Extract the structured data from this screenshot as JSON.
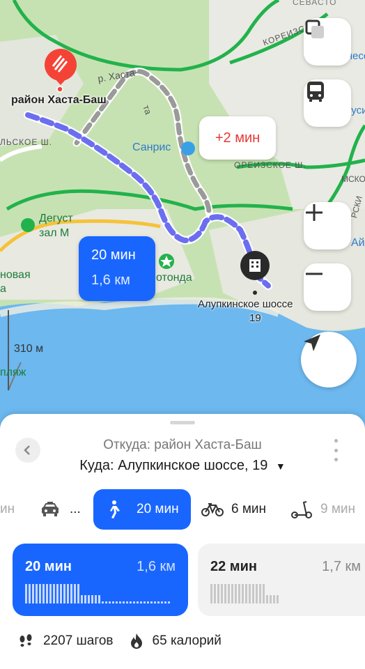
{
  "map": {
    "places": {
      "start_area": "район Хаста-Баш",
      "sevastop": "СЕВАСТО",
      "koreiz_top": "КОРЕИЗС",
      "reness": "Ренесса",
      "ulitsa": "р. Хаста-",
      "ta": "та",
      "alsk": "ЛЬСКОЕ Ш.",
      "sanris": "Санрис",
      "koreiz_road": "ОРЕИЗСКОЕ Ш.",
      "degust_1": "Дегуст",
      "degust_2": "зал М",
      "beach_left_1": "новая",
      "beach_left_2": "а",
      "rotonda": "отонда",
      "dest_1": "Алупкинское шоссе",
      "dest_2": "19",
      "sk": "РСКИ",
      "ai": "Ай",
      "nusi": "нуси",
      "mskoe": "МСКОЕ",
      "plyazh": "пляж",
      "scale": "310 м"
    },
    "traffic_bubble": "+2 мин",
    "route_bubble": {
      "time": "20 мин",
      "distance": "1,6 км"
    },
    "colors": {
      "route": "#6c6ef0",
      "alt_route": "#9a9a9a",
      "sea": "#6cb8ef",
      "land": "#c9e3b4",
      "road": "#22b24c",
      "yellow": "#f5c23a"
    }
  },
  "controls": {
    "layers_icon": "layers-icon",
    "transit_icon": "bus-icon",
    "zoom_in_icon": "plus-icon",
    "zoom_out_icon": "minus-icon",
    "locate_icon": "navigation-arrow-icon"
  },
  "sheet": {
    "from": "Откуда: район Хаста-Баш",
    "to": "Куда: Алупкинское шоссе, 19",
    "tabs": [
      {
        "label": "ин",
        "icon": ""
      },
      {
        "label": "...",
        "icon": "taxi-icon"
      },
      {
        "label": "20 мин",
        "icon": "walk-icon",
        "active": true
      },
      {
        "label": "6 мин",
        "icon": "bicycle-icon"
      },
      {
        "label": "9 мин",
        "icon": "scooter-icon"
      }
    ],
    "routes": [
      {
        "time": "20 мин",
        "distance": "1,6 км",
        "selected": true
      },
      {
        "time": "22 мин",
        "distance": "1,7 км",
        "selected": false
      }
    ],
    "stats": {
      "steps": "2207 шагов",
      "calories": "65 калорий"
    },
    "colors": {
      "accent": "#1966ff"
    }
  }
}
